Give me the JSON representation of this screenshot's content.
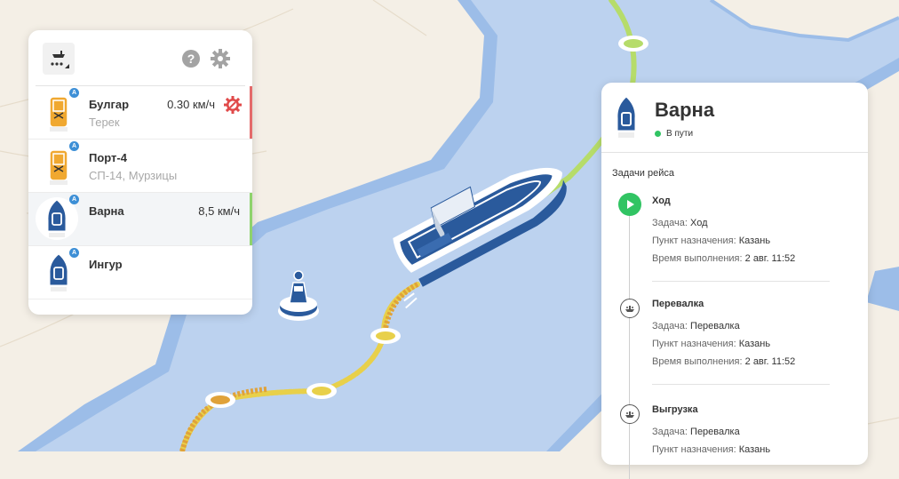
{
  "toolbar": {
    "layers_icon": "vessel-layers-icon",
    "help_icon": "help-icon",
    "settings_icon": "gear-icon"
  },
  "vessels": [
    {
      "name": "Булгар",
      "sub": "Терек",
      "speed": "0.30 км/ч",
      "badge": "A",
      "alert": true,
      "selected": false,
      "stripe_color": "#e46b6b",
      "color": "#f0a830"
    },
    {
      "name": "Порт-4",
      "sub": "СП-14, Мурзицы",
      "speed": "",
      "badge": "A",
      "alert": false,
      "selected": false,
      "stripe_color": "",
      "color": "#f0a830"
    },
    {
      "name": "Варна",
      "sub": "",
      "speed": "8,5 км/ч",
      "badge": "A",
      "alert": false,
      "selected": true,
      "stripe_color": "#8fd36c",
      "color": "#2a5a9c"
    },
    {
      "name": "Ингур",
      "sub": "",
      "speed": "",
      "badge": "A",
      "alert": false,
      "selected": false,
      "stripe_color": "",
      "color": "#2a5a9c"
    }
  ],
  "detail": {
    "title": "Варна",
    "status": "В пути",
    "status_color": "#31c463",
    "section_title": "Задачи рейса",
    "tasks": [
      {
        "name": "Ход",
        "icon": "play-icon",
        "active": true,
        "task_label": "Задача:",
        "task_value": "Ход",
        "dest_label": "Пункт назначения:",
        "dest_value": "Казань",
        "time_label": "Время выполнения:",
        "time_value": "2 авг. 11:52"
      },
      {
        "name": "Перевалка",
        "icon": "cargo-icon",
        "active": false,
        "task_label": "Задача:",
        "task_value": "Перевалка",
        "dest_label": "Пункт назначения:",
        "dest_value": "Казань",
        "time_label": "Время выполнения:",
        "time_value": "2 авг. 11:52"
      },
      {
        "name": "Выгрузка",
        "icon": "cargo-icon",
        "active": false,
        "task_label": "Задача:",
        "task_value": "Перевалка",
        "dest_label": "Пункт назначения:",
        "dest_value": "Казань",
        "time_label": "",
        "time_value": ""
      }
    ]
  },
  "colors": {
    "water": "#bcd2ef",
    "water_edge": "#9cbde8",
    "land": "#f4efe6",
    "route_green": "#b6dc6a",
    "route_yellow": "#e8d04a",
    "route_orange": "#e0a23a",
    "boat_blue": "#2a5a9c"
  }
}
